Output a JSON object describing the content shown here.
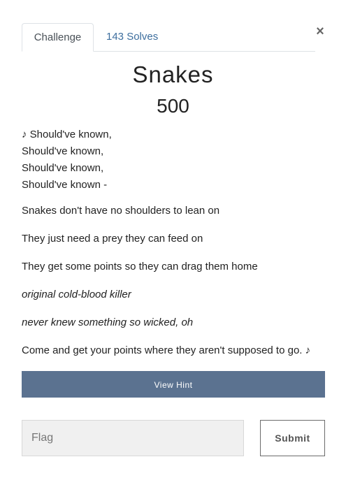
{
  "tabs": {
    "challenge_label": "Challenge",
    "solves_label": "143 Solves"
  },
  "close_label": "×",
  "challenge": {
    "name": "Snakes",
    "value": "500",
    "verse": [
      "♪ Should've known,",
      "Should've known,",
      "Should've known,",
      "Should've known -"
    ],
    "lines": [
      "Snakes don't have no shoulders to lean on",
      "They just need a prey they can feed on",
      "They get some points so they can drag them home",
      "original cold-blood killer",
      "never knew something so wicked, oh",
      "Come and get your points where they aren't supposed to go. ♪"
    ]
  },
  "hint": {
    "label": "View Hint"
  },
  "flag": {
    "placeholder": "Flag",
    "value": ""
  },
  "submit": {
    "label": "Submit"
  },
  "colors": {
    "link": "#3d6e9e",
    "hint_button": "#5b7290",
    "input_bg": "#f0f0f0"
  }
}
